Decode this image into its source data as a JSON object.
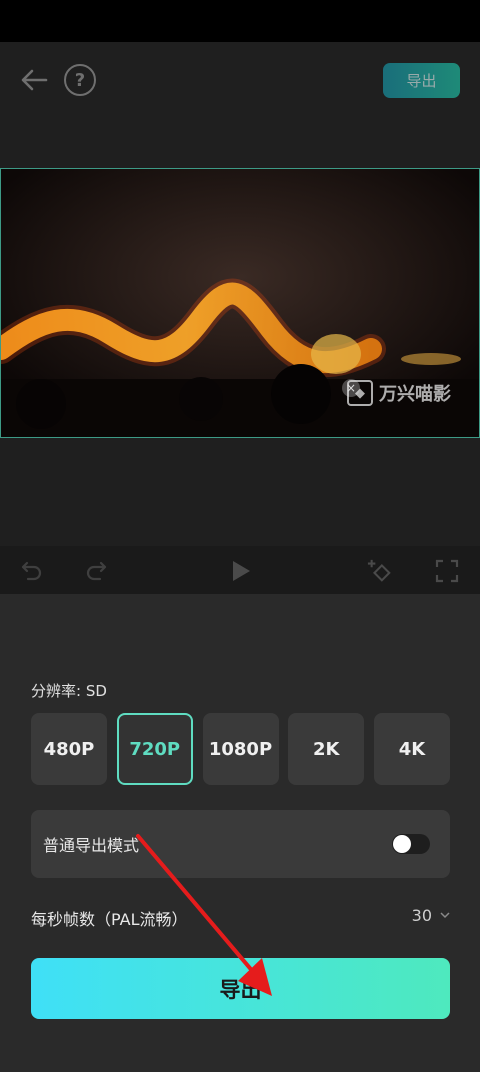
{
  "header": {
    "export_label": "导出"
  },
  "preview": {
    "watermark_text": "万兴喵影"
  },
  "panel": {
    "resolution_label": "分辨率:  SD",
    "resolutions": [
      {
        "label": "480P",
        "selected": false
      },
      {
        "label": "720P",
        "selected": true
      },
      {
        "label": "1080P",
        "selected": false
      },
      {
        "label": "2K",
        "selected": false
      },
      {
        "label": "4K",
        "selected": false
      }
    ],
    "mode_label": "普通导出模式",
    "mode_enabled": false,
    "fps_label": "每秒帧数（PAL流畅）",
    "fps_value": "30",
    "export_label": "导出"
  },
  "colors": {
    "accent": "#5fdcc1",
    "export_gradient_start": "#3fe0f7",
    "export_gradient_end": "#4ee9be",
    "annotation_arrow": "#e51c1c"
  },
  "icons": [
    "back-arrow-icon",
    "help-icon",
    "undo-icon",
    "redo-icon",
    "play-icon",
    "keyframe-icon",
    "fullscreen-icon",
    "chevron-down-icon"
  ]
}
